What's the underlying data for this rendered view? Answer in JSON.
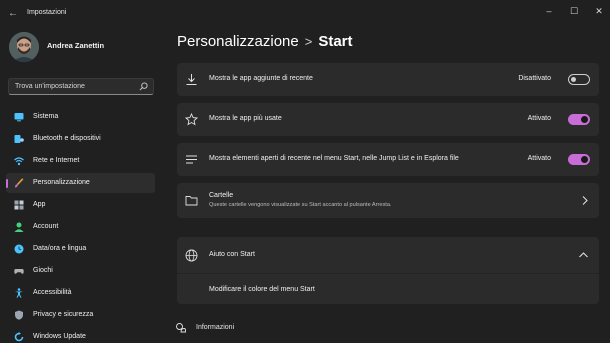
{
  "window": {
    "title": "Impostazioni",
    "controls": [
      "–",
      "☐",
      "✕"
    ]
  },
  "user": {
    "name": "Andrea Zanettin"
  },
  "search": {
    "placeholder": "Trova un'impostazione"
  },
  "sidebar": {
    "items": [
      {
        "label": "Sistema",
        "icon": "monitor-icon",
        "color": "#4cc2ff"
      },
      {
        "label": "Bluetooth e dispositivi",
        "icon": "bluetooth-icon",
        "color": "#4cc2ff"
      },
      {
        "label": "Rete e Internet",
        "icon": "wifi-icon",
        "color": "#4cc2ff"
      },
      {
        "label": "Personalizzazione",
        "icon": "brush-icon",
        "color": "#e8a23c",
        "active": true
      },
      {
        "label": "App",
        "icon": "apps-icon",
        "color": "#9aa7b3"
      },
      {
        "label": "Account",
        "icon": "person-icon",
        "color": "#3fd37a"
      },
      {
        "label": "Data/ora e lingua",
        "icon": "globe-clock-icon",
        "color": "#4cc2ff"
      },
      {
        "label": "Giochi",
        "icon": "gamepad-icon",
        "color": "#b0b0b0"
      },
      {
        "label": "Accessibilità",
        "icon": "accessibility-icon",
        "color": "#4cc2ff"
      },
      {
        "label": "Privacy e sicurezza",
        "icon": "shield-icon",
        "color": "#9aa7b3"
      },
      {
        "label": "Windows Update",
        "icon": "update-icon",
        "color": "#4cc2ff"
      }
    ]
  },
  "breadcrumb": {
    "parent": "Personalizzazione",
    "separator": ">",
    "current": "Start"
  },
  "settings": [
    {
      "label": "Mostra le app aggiunte di recente",
      "state": "Disattivato",
      "on": false,
      "icon": "download-icon"
    },
    {
      "label": "Mostra le app più usate",
      "state": "Attivato",
      "on": true,
      "icon": "star-icon"
    },
    {
      "label": "Mostra elementi aperti di recente nel menu Start, nelle Jump List e in Esplora file",
      "state": "Attivato",
      "on": true,
      "icon": "list-icon"
    }
  ],
  "folders": {
    "title": "Cartelle",
    "subtitle": "Queste cartelle vengono visualizzate su Start accanto al pulsante Arresta.",
    "icon": "folder-icon"
  },
  "help": {
    "title": "Aiuto con Start",
    "link": "Modificare il colore del menu Start",
    "icon": "globe-icon"
  },
  "info": {
    "label": "Informazioni",
    "icon": "feedback-icon"
  },
  "colors": {
    "accent": "#c86dd7",
    "background": "#202020",
    "card": "#2b2b2b"
  }
}
